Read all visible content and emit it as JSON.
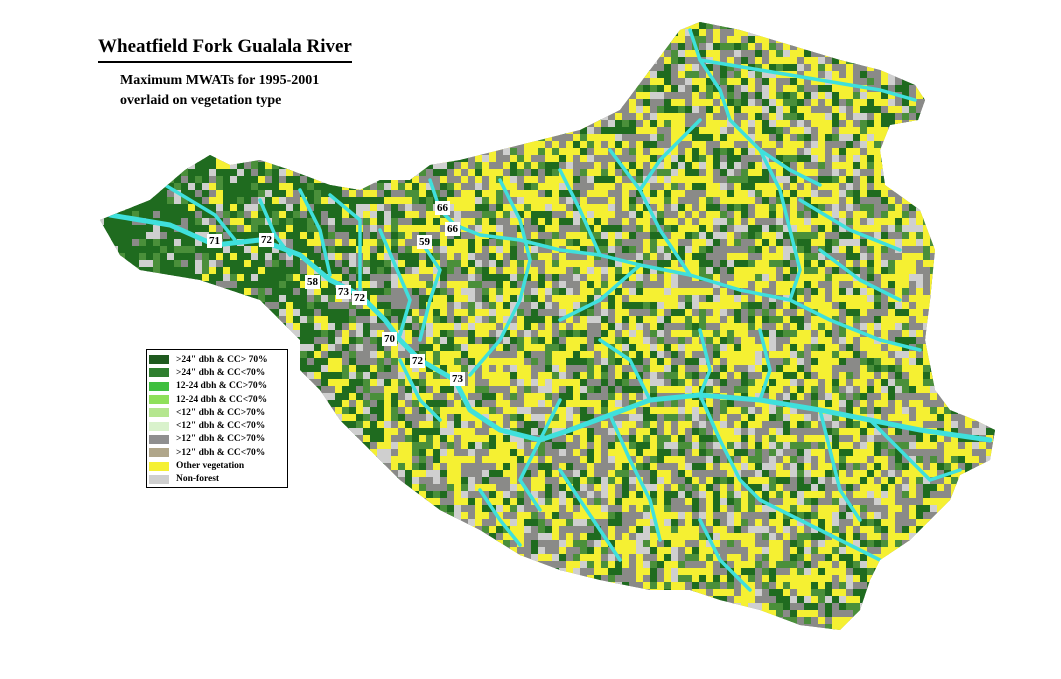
{
  "map": {
    "title": "Wheatfield Fork Gualala River",
    "subtitle_line1": "Maximum MWATs for 1995-2001",
    "subtitle_line2": "overlaid on vegetation type"
  },
  "legend": {
    "items": [
      {
        "label": ">24\" dbh & CC> 70%",
        "color": "#1f5a1f"
      },
      {
        "label": ">24\" dbh & CC<70%",
        "color": "#2f7f2f"
      },
      {
        "label": "12-24 dbh & CC>70%",
        "color": "#3fbf3f"
      },
      {
        "label": "12-24 dbh & CC<70%",
        "color": "#8fe05a"
      },
      {
        "label": "<12\" dbh & CC>70%",
        "color": "#b5e68f"
      },
      {
        "label": "<12\" dbh & CC<70%",
        "color": "#d9f2cc"
      },
      {
        "label": ">12\" dbh & CC>70%",
        "color": "#8f8f8f"
      },
      {
        "label": ">12\" dbh & CC<70%",
        "color": "#b0a68a"
      },
      {
        "label": "Other vegetation",
        "color": "#f5f032"
      },
      {
        "label": "Non-forest",
        "color": "#cfcfcf"
      }
    ]
  },
  "temperature_labels": [
    "71",
    "72",
    "58",
    "73",
    "72",
    "66",
    "66",
    "59",
    "70",
    "72",
    "73"
  ],
  "colors": {
    "stream": "#3fe0dc",
    "dense_forest": "#1f6b1f",
    "other_vegetation": "#f5f032",
    "gray_forest": "#8a8a88",
    "non_forest": "#cfcfcf"
  }
}
